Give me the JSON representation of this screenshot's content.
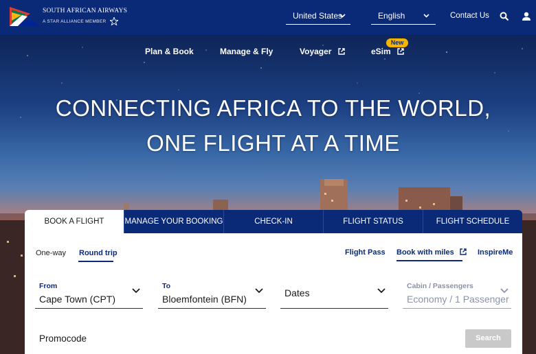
{
  "brand": {
    "name": "SOUTH AFRICAN AIRWAYS",
    "tagline": "A STAR ALLIANCE MEMBER"
  },
  "header": {
    "country": "United States",
    "language": "English",
    "contact": "Contact Us"
  },
  "nav": {
    "items": [
      "Plan & Book",
      "Manage & Fly",
      "Voyager",
      "eSim"
    ],
    "new_badge": "New"
  },
  "hero": {
    "line1": "CONNECTING AFRICA TO THE WORLD,",
    "line2": "ONE FLIGHT AT A TIME"
  },
  "booking": {
    "tabs": [
      "BOOK A FLIGHT",
      "MANAGE YOUR BOOKING",
      "CHECK-IN",
      "FLIGHT STATUS",
      "FLIGHT SCHEDULE"
    ],
    "active_tab": "BOOK A FLIGHT",
    "trip_types": [
      "One-way",
      "Round trip"
    ],
    "selected_trip": "Round trip",
    "links": [
      "Flight Pass",
      "Book with miles",
      "InspireMe"
    ],
    "from": {
      "label": "From",
      "value": "Cape Town (CPT)"
    },
    "to": {
      "label": "To",
      "value": "Bloemfontein (BFN)"
    },
    "dates": {
      "label": "Dates"
    },
    "cabin": {
      "label": "Cabin / Passengers",
      "value": "Economy / 1 Passenger"
    },
    "promocode": "Promocode",
    "search": "Search"
  },
  "colors": {
    "header_bg": "#0a2a78",
    "new_badge": "#f7b500",
    "search_disabled": "#c9c9c9"
  },
  "icons": [
    "search-icon",
    "user-icon",
    "external-link-icon",
    "chevron-down-icon",
    "star-alliance-icon"
  ]
}
